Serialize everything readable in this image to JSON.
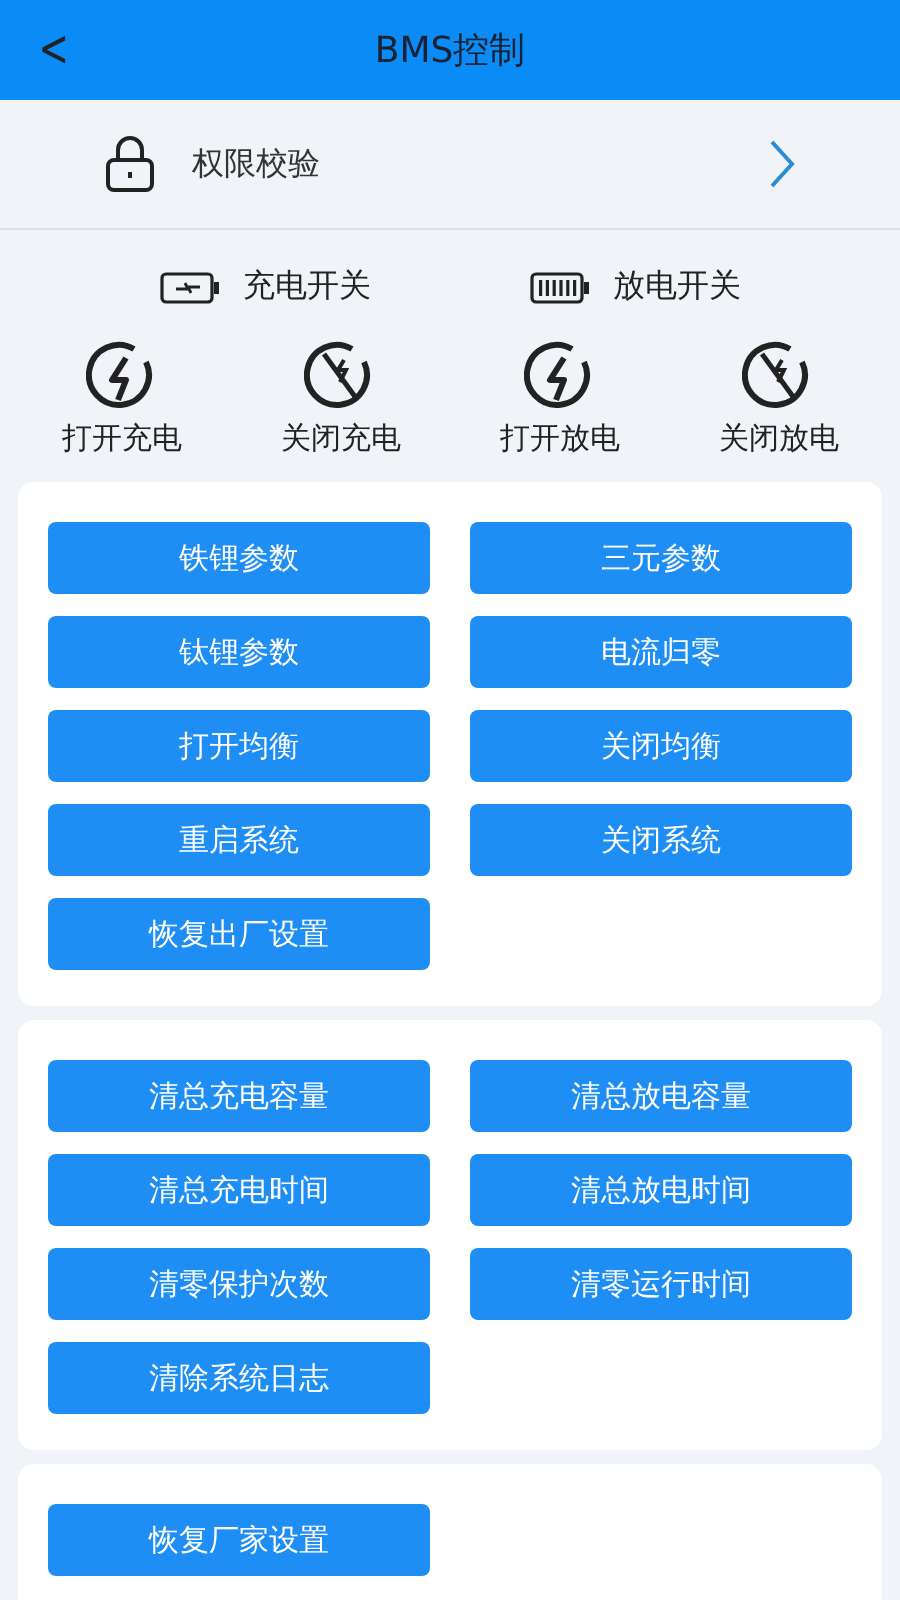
{
  "header": {
    "back": "<",
    "title": "BMS控制"
  },
  "auth_row": {
    "label": "权限校验"
  },
  "switches": [
    {
      "kind": "charge",
      "label": "充电开关"
    },
    {
      "kind": "discharge",
      "label": "放电开关"
    }
  ],
  "actions": [
    {
      "kind": "on",
      "label": "打开充电"
    },
    {
      "kind": "off",
      "label": "关闭充电"
    },
    {
      "kind": "on",
      "label": "打开放电"
    },
    {
      "kind": "off",
      "label": "关闭放电"
    }
  ],
  "cards": [
    {
      "buttons": [
        "铁锂参数",
        "三元参数",
        "钛锂参数",
        "电流归零",
        "打开均衡",
        "关闭均衡",
        "重启系统",
        "关闭系统",
        "恢复出厂设置"
      ]
    },
    {
      "buttons": [
        "清总充电容量",
        "清总放电容量",
        "清总充电时间",
        "清总放电时间",
        "清零保护次数",
        "清零运行时间",
        "清除系统日志"
      ]
    },
    {
      "buttons": [
        "恢复厂家设置"
      ]
    }
  ]
}
